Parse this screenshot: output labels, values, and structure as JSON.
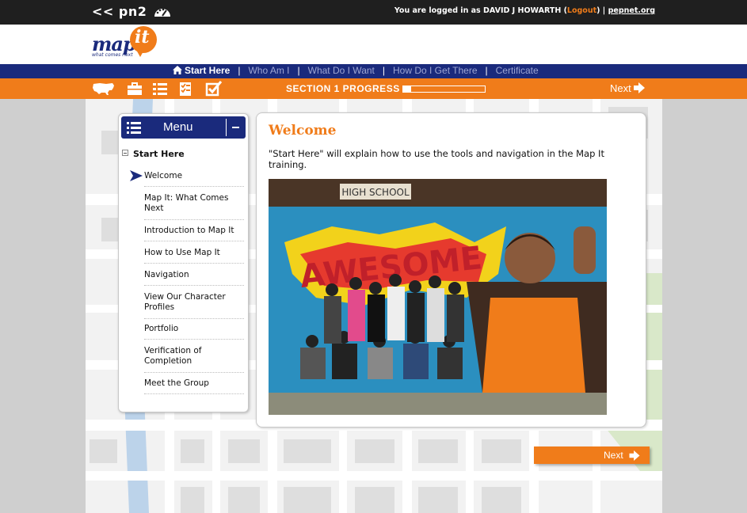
{
  "header": {
    "back_link": "<< pn2",
    "login_prefix": "You are logged in as DAVID J HOWARTH (",
    "logout_label": "Logout",
    "login_suffix": ") | ",
    "site_link": "pepnet.org"
  },
  "logo": {
    "word1": "map",
    "word2": "it",
    "tagline": "what comes next"
  },
  "nav": {
    "items": [
      {
        "label": "Start Here",
        "active": true
      },
      {
        "label": "Who Am I"
      },
      {
        "label": "What Do I Want"
      },
      {
        "label": "How Do I Get There"
      },
      {
        "label": "Certificate"
      }
    ],
    "separator": "|"
  },
  "toolbar": {
    "icons": [
      "us-map-icon",
      "briefcase-icon",
      "list-icon",
      "checklist-icon",
      "checkbox-icon"
    ],
    "progress_label": "SECTION 1 PROGRESS",
    "progress_fraction": 0.1,
    "next_label": "Next"
  },
  "menu": {
    "title": "Menu",
    "section": "Start Here",
    "items": [
      {
        "label": "Welcome",
        "current": true
      },
      {
        "label": "Map It: What Comes Next"
      },
      {
        "label": "Introduction to Map It"
      },
      {
        "label": "How to Use Map It"
      },
      {
        "label": "Navigation"
      },
      {
        "label": "View Our Character Profiles"
      },
      {
        "label": "Portfolio"
      },
      {
        "label": "Verification of Completion"
      },
      {
        "label": "Meet the Group"
      }
    ]
  },
  "main": {
    "title": "Welcome",
    "intro": "\"Start Here\" will explain how to use the tools and navigation in the Map It training.",
    "photo": {
      "sign": "HIGH SCHOOL",
      "mural_text": "AWESOME"
    }
  },
  "footer": {
    "next_label": "Next"
  },
  "colors": {
    "navy": "#1a2a7c",
    "orange": "#f07c1a",
    "top_bar": "#1f1f1f"
  }
}
